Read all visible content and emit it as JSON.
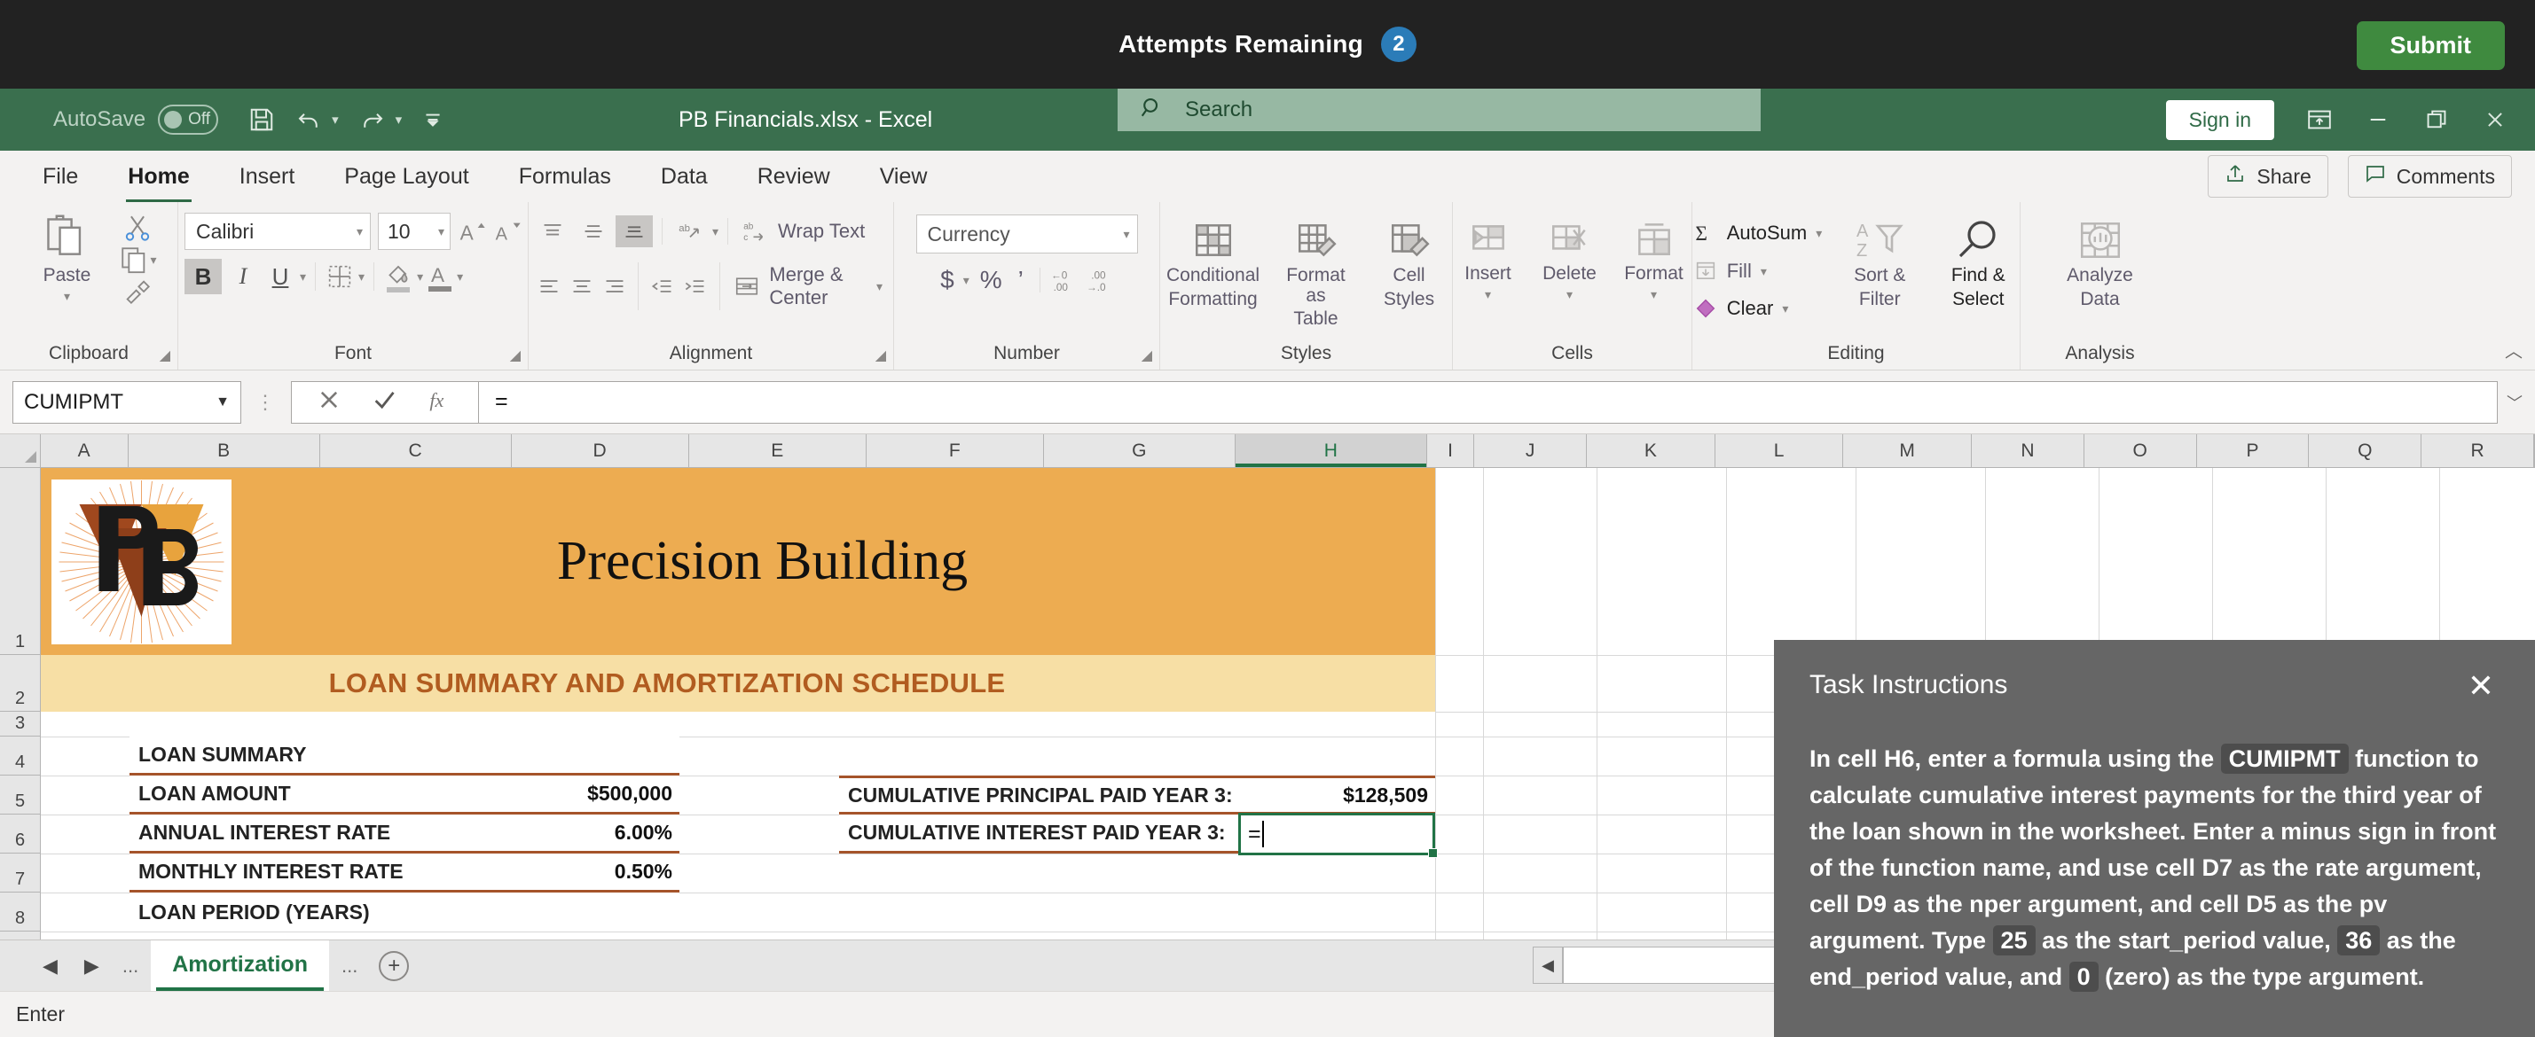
{
  "taskbar": {
    "attempts_label": "Attempts Remaining",
    "attempts_count": "2",
    "submit_label": "Submit",
    "badge_color": "#2b7cb8",
    "submit_color": "#3f8a3f"
  },
  "titlebar": {
    "autosave_label": "AutoSave",
    "autosave_state": "Off",
    "document_title": "PB Financials.xlsx - Excel",
    "signin_label": "Sign in",
    "background_color": "#3a6f4e"
  },
  "search": {
    "placeholder": "Search"
  },
  "ribbon_tabs": [
    {
      "label": "File",
      "active": false
    },
    {
      "label": "Home",
      "active": true
    },
    {
      "label": "Insert",
      "active": false
    },
    {
      "label": "Page Layout",
      "active": false
    },
    {
      "label": "Formulas",
      "active": false
    },
    {
      "label": "Data",
      "active": false
    },
    {
      "label": "Review",
      "active": false
    },
    {
      "label": "View",
      "active": false
    }
  ],
  "ribbon_right": {
    "share_label": "Share",
    "comments_label": "Comments"
  },
  "ribbon": {
    "clipboard": {
      "group_label": "Clipboard",
      "paste_label": "Paste",
      "cut_label": "Cut",
      "copy_label": "Copy",
      "format_painter_label": "Format Painter"
    },
    "font": {
      "group_label": "Font",
      "font_name": "Calibri",
      "font_size": "10",
      "grow_label": "A",
      "shrink_label": "A",
      "bold_label": "B",
      "italic_label": "I",
      "underline_label": "U"
    },
    "alignment": {
      "group_label": "Alignment",
      "wrap_text_label": "Wrap Text",
      "merge_center_label": "Merge & Center"
    },
    "number": {
      "group_label": "Number",
      "format": "Currency",
      "currency_symbol": "$",
      "percent_symbol": "%",
      "comma_symbol": "’"
    },
    "styles": {
      "group_label": "Styles",
      "conditional_formatting_l1": "Conditional",
      "conditional_formatting_l2": "Formatting",
      "format_as_table_l1": "Format as",
      "format_as_table_l2": "Table",
      "cell_styles_l1": "Cell",
      "cell_styles_l2": "Styles"
    },
    "cells": {
      "group_label": "Cells",
      "insert_label": "Insert",
      "delete_label": "Delete",
      "format_label": "Format"
    },
    "editing": {
      "group_label": "Editing",
      "autosum_label": "AutoSum",
      "fill_label": "Fill",
      "clear_label": "Clear",
      "sort_filter_l1": "Sort &",
      "sort_filter_l2": "Filter",
      "find_select_l1": "Find &",
      "find_select_l2": "Select"
    },
    "analysis": {
      "group_label": "Analysis",
      "analyze_data_l1": "Analyze",
      "analyze_data_l2": "Data"
    }
  },
  "formula_bar": {
    "name_box": "CUMIPMT",
    "cancel_icon": "cancel-icon",
    "enter_icon": "enter-icon",
    "fx_label": "fx",
    "formula_value": "="
  },
  "grid": {
    "columns": [
      "A",
      "B",
      "C",
      "D",
      "E",
      "F",
      "G",
      "H",
      "I",
      "J",
      "K",
      "L",
      "M",
      "N",
      "O",
      "P",
      "Q",
      "R"
    ],
    "selected_column": "H",
    "rows": [
      "1",
      "2",
      "3",
      "4",
      "5",
      "6",
      "7",
      "8"
    ],
    "banner_title": "Precision Building",
    "banner_subtitle": "LOAN SUMMARY AND AMORTIZATION SCHEDULE",
    "banner_color": "#edac51",
    "subtitle_band_color": "#f7dfa5",
    "subtitle_text_color": "#b15c20",
    "logo_text": "PB",
    "loan_summary": {
      "title": "LOAN SUMMARY",
      "rows": [
        {
          "label": "LOAN AMOUNT",
          "value": "$500,000"
        },
        {
          "label": "ANNUAL INTEREST RATE",
          "value": "6.00%"
        },
        {
          "label": "MONTHLY INTEREST RATE",
          "value": "0.50%"
        },
        {
          "label": "LOAN PERIOD (YEARS)",
          "value": ""
        }
      ]
    },
    "cumulative": {
      "rows": [
        {
          "label": "CUMULATIVE PRINCIPAL PAID YEAR 3:",
          "value": "$128,509"
        },
        {
          "label": "CUMULATIVE INTEREST PAID YEAR 3:",
          "value": ""
        }
      ]
    },
    "active_cell": {
      "address": "H6",
      "content": "="
    }
  },
  "sheet_tabs": {
    "first_arrow": "◀",
    "last_arrow": "▶",
    "left_dots": "...",
    "right_dots": "...",
    "active_tab": "Amortization",
    "add_sheet": "+"
  },
  "status_bar": {
    "mode": "Enter"
  },
  "instructions": {
    "title": "Task Instructions",
    "close": "✕",
    "segments": [
      {
        "type": "text",
        "value": "In cell H6, enter a formula using the "
      },
      {
        "type": "code",
        "value": "CUMIPMT"
      },
      {
        "type": "text",
        "value": " function to calculate cumulative interest payments for the third year of the loan shown in the worksheet. Enter a minus sign in front of the function name, and use cell D7 as the rate argument, cell D9 as the nper argument, and cell D5 as the pv argument. Type "
      },
      {
        "type": "code",
        "value": "25"
      },
      {
        "type": "text",
        "value": " as the start_period value, "
      },
      {
        "type": "code",
        "value": "36"
      },
      {
        "type": "text",
        "value": " as the end_period value, and "
      },
      {
        "type": "code",
        "value": "0"
      },
      {
        "type": "text",
        "value": " (zero) as the type argument."
      }
    ],
    "panel_color": "#666666"
  }
}
